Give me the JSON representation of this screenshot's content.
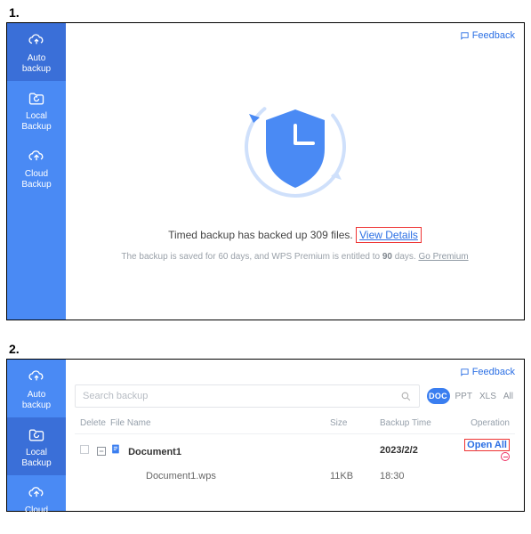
{
  "steps": {
    "one": "1.",
    "two": "2."
  },
  "feedback_label": "Feedback",
  "sidebar": {
    "items": [
      {
        "label_l1": "Auto",
        "label_l2": "backup",
        "name": "sidebar-item-auto-backup"
      },
      {
        "label_l1": "Local",
        "label_l2": "Backup",
        "name": "sidebar-item-local-backup"
      },
      {
        "label_l1": "Cloud",
        "label_l2": "Backup",
        "name": "sidebar-item-cloud-backup"
      }
    ]
  },
  "panel1": {
    "status_prefix": "Timed backup has backed up ",
    "status_count": "309",
    "status_suffix": " files.",
    "view_details": "View Details",
    "sub_prefix": "The backup is saved for 60 days, and WPS Premium is entitled to ",
    "sub_days": "90",
    "sub_suffix": " days. ",
    "go_premium": "Go Premium"
  },
  "panel2": {
    "search_placeholder": "Search backup",
    "filters": {
      "doc": "DOC",
      "ppt": "PPT",
      "xls": "XLS",
      "all": "All"
    },
    "columns": {
      "delete": "Delete",
      "filename": "File Name",
      "size": "Size",
      "backup_time": "Backup Time",
      "operation": "Operation"
    },
    "rows": {
      "group": {
        "name": "Document1",
        "date": "2023/2/2",
        "open_all": "Open All"
      },
      "child": {
        "name": "Document1.wps",
        "size": "11KB",
        "time": "18:30"
      }
    }
  }
}
